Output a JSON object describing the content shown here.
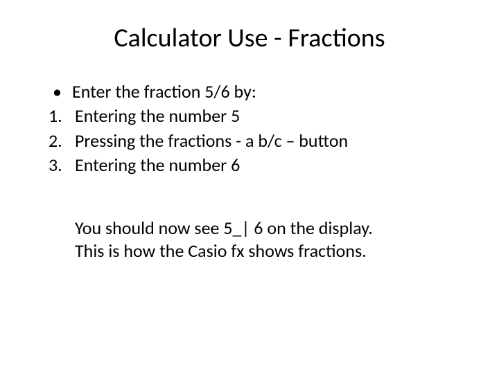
{
  "title": "Calculator Use - Fractions",
  "bullet": {
    "marker": "•",
    "text": "Enter the fraction 5/6 by:"
  },
  "steps": [
    {
      "num": "1.",
      "text": "Entering the number 5"
    },
    {
      "num": "2.",
      "text": "Pressing the fractions  - a b/c – button"
    },
    {
      "num": "3.",
      "text": "Entering the number 6"
    }
  ],
  "paragraph_line1": "You should now see 5_| 6  on the display.",
  "paragraph_line2": "This is how the Casio fx shows fractions."
}
